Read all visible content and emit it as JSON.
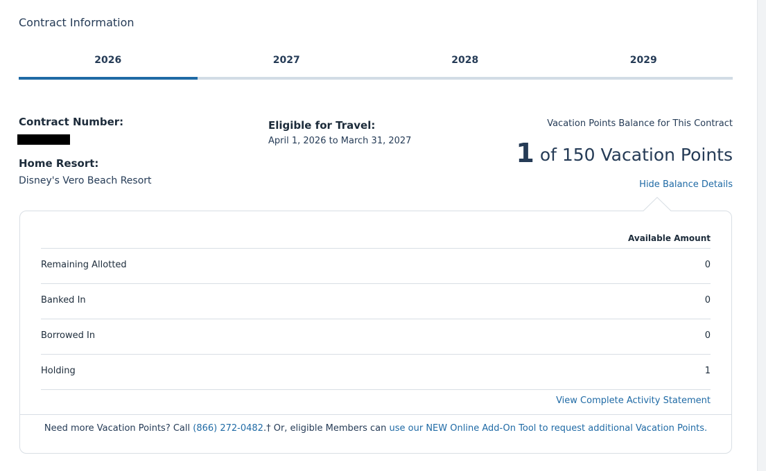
{
  "section_title": "Contract Information",
  "tabs": [
    {
      "label": "2026",
      "active": true
    },
    {
      "label": "2027",
      "active": false
    },
    {
      "label": "2028",
      "active": false
    },
    {
      "label": "2029",
      "active": false
    }
  ],
  "contract": {
    "number_label": "Contract Number:",
    "home_resort_label": "Home Resort:",
    "home_resort_value": "Disney's Vero Beach Resort",
    "eligible_label": "Eligible for Travel:",
    "eligible_value": "April 1, 2026 to March 31, 2027"
  },
  "balance": {
    "title": "Vacation Points Balance for This Contract",
    "current": "1",
    "of_text": "of 150 Vacation Points",
    "hide_link": "Hide Balance Details"
  },
  "details": {
    "column_header": "Available Amount",
    "rows": [
      {
        "label": "Remaining Allotted",
        "value": "0"
      },
      {
        "label": "Banked In",
        "value": "0"
      },
      {
        "label": "Borrowed In",
        "value": "0"
      },
      {
        "label": "Holding",
        "value": "1"
      }
    ],
    "statement_link": "View Complete Activity Statement"
  },
  "footer": {
    "text_before": "Need more Vacation Points? Call ",
    "phone": "(866) 272-0482",
    "text_middle": ".† Or, eligible Members can ",
    "addon_link": "use our NEW Online Add-On Tool to request additional Vacation Points."
  },
  "colors": {
    "accent": "#1f6aa5",
    "tab_track": "#d2dce5",
    "text": "#253b56"
  }
}
